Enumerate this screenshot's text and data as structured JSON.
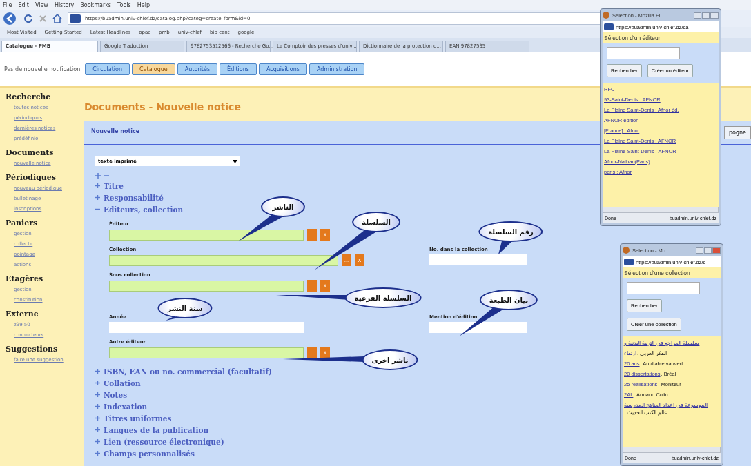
{
  "browser": {
    "menu": [
      "File",
      "Edit",
      "View",
      "History",
      "Bookmarks",
      "Tools",
      "Help"
    ],
    "url": "https://buadmin.univ-chlef.dz/catalog.php?categ=create_form&id=0",
    "bookmarks": [
      "Most Visited",
      "Getting Started",
      "Latest Headlines",
      "opac",
      "pmb",
      "univ-chlef",
      "bib cent",
      "google"
    ],
    "tabs": [
      {
        "label": "Catalogue - PMB",
        "selected": true
      },
      {
        "label": "Google Traduction",
        "selected": false
      },
      {
        "label": "9782753512566 - Recherche Go...",
        "selected": false
      },
      {
        "label": "Le Comptoir des presses d'univ...",
        "selected": false
      },
      {
        "label": "Dictionnaire de la protection d...",
        "selected": false
      },
      {
        "label": "EAN 97827535",
        "selected": false
      }
    ]
  },
  "app": {
    "notification": "Pas de nouvelle notification",
    "modules": [
      {
        "label": "Circulation",
        "selected": false
      },
      {
        "label": "Catalogue",
        "selected": true
      },
      {
        "label": "Autorités",
        "selected": false
      },
      {
        "label": "Éditions",
        "selected": false
      },
      {
        "label": "Acquisitions",
        "selected": false
      },
      {
        "label": "Administration",
        "selected": false
      }
    ]
  },
  "sidebar": [
    {
      "title": "Recherche",
      "items": [
        "toutes notices",
        "périodiques",
        "dernières notices",
        "prédéfinie"
      ]
    },
    {
      "title": "Documents",
      "items": [
        "nouvelle notice"
      ]
    },
    {
      "title": "Périodiques",
      "items": [
        "nouveau périodique",
        "bulletinage",
        "inscriptions"
      ]
    },
    {
      "title": "Paniers",
      "items": [
        "gestion",
        "collecte",
        "pointage",
        "actions"
      ]
    },
    {
      "title": "Etagères",
      "items": [
        "gestion",
        "constitution"
      ]
    },
    {
      "title": "Externe",
      "items": [
        "z39.50",
        "connecteurs"
      ]
    },
    {
      "title": "Suggestions",
      "items": [
        "faire une suggestion"
      ]
    }
  ],
  "page": {
    "title": "Documents - Nouvelle notice",
    "form_title": "Nouvelle notice",
    "side_button": "pogne",
    "doc_type": "texte imprimé",
    "sections_before": [
      {
        "label": "Titre",
        "expanded": false
      },
      {
        "label": "Responsabilité",
        "expanded": false
      },
      {
        "label": "Editeurs, collection",
        "expanded": true
      }
    ],
    "field_rows": [
      {
        "fields": [
          {
            "label": "Éditeur",
            "kind": "lookup",
            "buttons": [
              "...",
              "X"
            ]
          }
        ]
      },
      {
        "fields": [
          {
            "label": "Collection",
            "kind": "lookup",
            "buttons": [
              "...",
              "X"
            ]
          },
          {
            "label": "No. dans la collection",
            "kind": "short"
          }
        ]
      },
      {
        "fields": [
          {
            "label": "Sous collection",
            "kind": "lookup",
            "buttons": [
              "...",
              "X"
            ]
          }
        ]
      },
      {
        "fields": [
          {
            "label": "Année",
            "kind": "plain"
          },
          {
            "label": "Mention d'édition",
            "kind": "short"
          }
        ]
      },
      {
        "fields": [
          {
            "label": "Autre éditeur",
            "kind": "lookup",
            "buttons": [
              "...",
              "X"
            ]
          }
        ]
      }
    ],
    "sections_after": [
      {
        "label": "ISBN, EAN ou no. commercial (facultatif)",
        "expanded": false
      },
      {
        "label": "Collation",
        "expanded": false
      },
      {
        "label": "Notes",
        "expanded": false
      },
      {
        "label": "Indexation",
        "expanded": false
      },
      {
        "label": "Titres uniformes",
        "expanded": false
      },
      {
        "label": "Langues de la publication",
        "expanded": false
      },
      {
        "label": "Lien (ressource électronique)",
        "expanded": false
      },
      {
        "label": "Champs personnalisés",
        "expanded": false
      }
    ],
    "callouts": [
      "الناشر",
      "السلسلة",
      "رقم السلسلة",
      "بيان الطبعة",
      "السلسلة الفرعية",
      "سنة النشر",
      "ناشر اخرى"
    ]
  },
  "popups": [
    {
      "title": "Sélection - Mozilla Fi...",
      "url": "https://buadmin.univ-chlef.dz/ca",
      "heading": "Sélection d'un éditeur",
      "buttons": [
        "Rechercher",
        "Créer un éditeur"
      ],
      "results": [
        {
          "link": "RFC"
        },
        {
          "link": "93-Saint-Denis : AFNOR"
        },
        {
          "link": "La Plaine Saint-Denis : Afnor éd."
        },
        {
          "link": "AFNOR édition"
        },
        {
          "link": "[France] : Afnor"
        },
        {
          "link": "La Plaine Saint-Denis : AFNOR"
        },
        {
          "link": "La Plaine-Saint-Denis : AFNOR"
        },
        {
          "link": "Afnor-Nathan(Paris)"
        },
        {
          "link": "paris : Afnor"
        }
      ],
      "status": "Done",
      "host": "buadmin.univ-chlef.dz"
    },
    {
      "title": "Selection - Mo...",
      "url": "https://buadmin.univ-chlef.dz/c",
      "heading": "Sélection d'une collection",
      "buttons": [
        "Rechercher",
        "Créer une collection"
      ],
      "results": [
        {
          "link": "سلسلة المراجع في التربية البدنية و"
        },
        {
          "link": "ارتقاء",
          "extra": ". الفكر العربي"
        },
        {
          "link": "20 ans",
          "extra": ". Au diable vauvert"
        },
        {
          "link": "20 dissertations",
          "extra": ". Bréal"
        },
        {
          "link": "25 réalisations",
          "extra": ". Moniteur"
        },
        {
          "link": "2AL",
          "extra": ". Armand Colin"
        },
        {
          "link": "الموسوعة في اعداد المناهج المدرسية",
          "extra": ". عالم الكتب الحديث"
        }
      ],
      "status": "Done",
      "host": "buadmin.univ-chlef.dz"
    }
  ]
}
